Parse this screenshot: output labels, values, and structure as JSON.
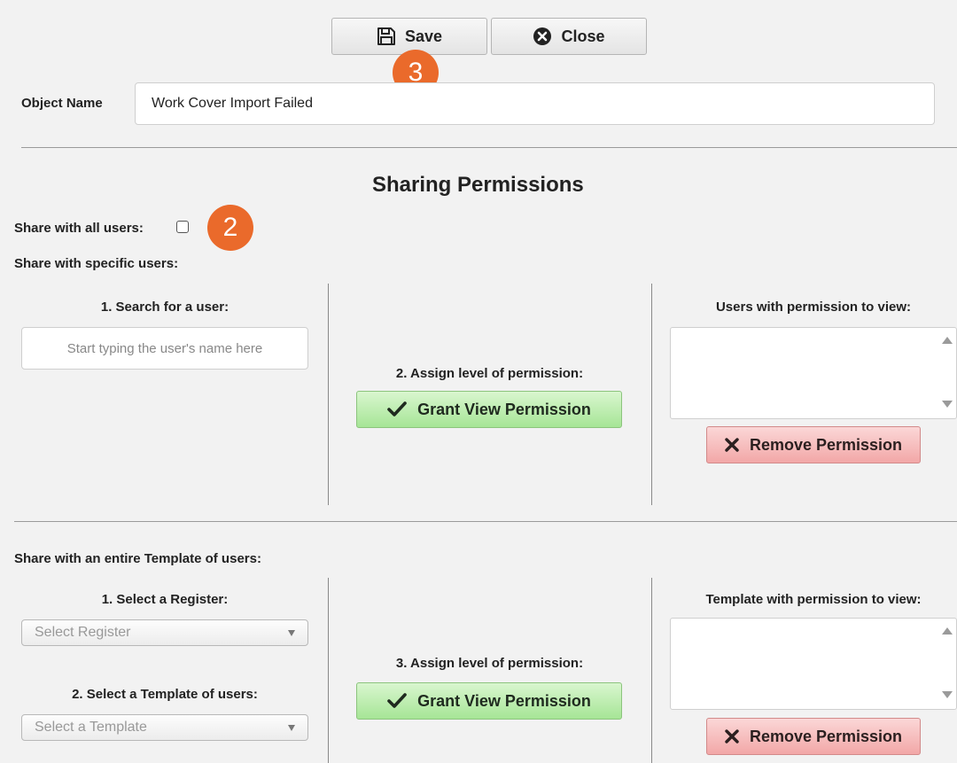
{
  "toolbar": {
    "save_label": "Save",
    "close_label": "Close"
  },
  "callouts": {
    "save_marker": "3",
    "share_all_marker": "2"
  },
  "object": {
    "label": "Object Name",
    "value": "Work Cover Import Failed"
  },
  "sharing": {
    "title": "Sharing Permissions",
    "share_all_label": "Share with all users:",
    "share_all_checked": false,
    "specific_label": "Share with specific users:"
  },
  "users_section": {
    "search_heading": "1. Search for a user:",
    "search_placeholder": "Start typing the user's name here",
    "assign_heading": "2. Assign level of permission:",
    "grant_label": "Grant View Permission",
    "list_heading": "Users with permission to view:",
    "remove_label": "Remove Permission"
  },
  "template_section": {
    "heading": "Share with an entire Template of users:",
    "register_heading": "1. Select a Register:",
    "register_placeholder": "Select Register",
    "template_heading": "2. Select a Template of users:",
    "template_placeholder": "Select a Template",
    "assign_heading": "3. Assign level of permission:",
    "grant_label": "Grant View Permission",
    "list_heading": "Template with permission to view:",
    "remove_label": "Remove Permission"
  },
  "colors": {
    "callout": "#ea6a2b",
    "grant_button": "#b8ebaa",
    "remove_button": "#f5baba"
  }
}
